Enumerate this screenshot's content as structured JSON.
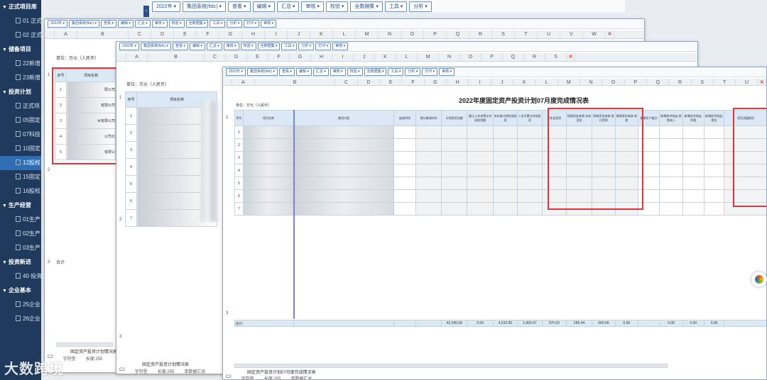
{
  "sidebar": {
    "groups": [
      {
        "label": "正式项目库",
        "items": [
          "01 正式",
          "02 正式"
        ]
      },
      {
        "label": "储备项目",
        "items": [
          "22新增",
          "23新增"
        ]
      },
      {
        "label": "投资计划",
        "items": [
          "正式项",
          "05固定",
          "07科技",
          "10固定",
          "12股权",
          "15固定",
          "16股权"
        ]
      },
      {
        "label": "生产经营",
        "items": [
          "01生产",
          "02生产",
          "03生产"
        ]
      },
      {
        "label": "投资新进",
        "items": [
          "40 投资"
        ]
      },
      {
        "label": "企业基本",
        "items": [
          "25企业",
          "26企业"
        ]
      }
    ],
    "active_item": "12股权"
  },
  "toolbar_top": [
    "2022年",
    "集团系统(fidc)",
    "查看",
    "编辑",
    "汇总",
    "审核",
    "校验",
    "全数据集",
    "工具",
    "分析"
  ],
  "toolbar_small": [
    "2022年",
    "集团系统(fidc)",
    "查看",
    "编辑",
    "汇总",
    "审核",
    "校验",
    "全数据集",
    "工具",
    "分析",
    "打印",
    "审核"
  ],
  "window1": {
    "columns": [
      "A",
      "B",
      "C",
      "D",
      "E",
      "F",
      "G",
      "H",
      "I",
      "J",
      "K",
      "L",
      "M",
      "N",
      "O",
      "P",
      "Q",
      "R",
      "S",
      "T",
      "U",
      "V",
      "W"
    ],
    "unit_label": "单位：万元（人民币）",
    "headers": [
      "序号",
      "项目名称"
    ],
    "rows": [
      {
        "no": "1",
        "name": "限公司"
      },
      {
        "no": "2",
        "name": "有限公司"
      },
      {
        "no": "3",
        "name": "水有限公司"
      },
      {
        "no": "4",
        "name": "公司北"
      },
      {
        "no": "5",
        "name": "有限公"
      }
    ],
    "total_label": "合计",
    "sheet_tab": "固定资产投资计划情况表",
    "status": [
      "C2",
      "字符型",
      "长度:255"
    ]
  },
  "window2": {
    "columns": [
      "A",
      "B",
      "C",
      "D",
      "E",
      "F",
      "G",
      "H",
      "I",
      "J",
      "K",
      "L",
      "M",
      "N",
      "O",
      "P",
      "Q",
      "R",
      "S"
    ],
    "unit_label": "单位：万元（人民币）",
    "headers": [
      "序号",
      "项目名称"
    ],
    "rows": [
      {
        "no": "1",
        "name": "有限公司"
      },
      {
        "no": "2",
        "name": "有限公司"
      },
      {
        "no": "3",
        "name": "有限公司"
      },
      {
        "no": "4",
        "name": "有限公司"
      },
      {
        "no": "5",
        "name": "有限公司"
      },
      {
        "no": "6",
        "name": "有限公司"
      },
      {
        "no": "7",
        "name": "有限公司"
      }
    ],
    "sheet_tab": "固定资产投资计划情况表",
    "status": [
      "C2",
      "字符型",
      "长度:255",
      "单数据汇总"
    ]
  },
  "window3": {
    "columns": [
      "A",
      "B",
      "C",
      "D",
      "E",
      "F",
      "G",
      "H",
      "I",
      "J",
      "K",
      "L",
      "M",
      "N",
      "O",
      "P",
      "Q",
      "R",
      "S",
      "T",
      "U"
    ],
    "title": "2022年度固定资产投资计划07月度完成情况表",
    "unit_label": "单位：万元（人民币）",
    "headers": [
      "序号",
      "项目名称",
      "建设内容",
      "起始时间",
      "预计建成时间",
      "计划投资总额",
      "截止上年末累计完成投资额",
      "本年度计划完成投资",
      "1-本月累计完成投资",
      "资本金投资",
      "财政资金来源-自有资金",
      "财政资金来源-银行贷款",
      "财政资金来源-其他",
      "新增生产能力",
      "新增经济效益-销售收入",
      "新增经济效益-利税",
      "新增经济效益-税金",
      "项目进展情况"
    ],
    "rows": [
      "1",
      "2",
      "3",
      "4",
      "5",
      "6",
      "7"
    ],
    "totals": {
      "label": "合计",
      "plan_total": "42,545.68",
      "prior_total": "0.00",
      "year_plan": "4,532.90",
      "ytd": "1,905.07",
      "capital": "375.00",
      "own_funds": "285.44",
      "bank_loan": "665.66",
      "other": "0.00",
      "v1": "0.00",
      "v2": "0.00",
      "v3": "0.00"
    },
    "sheet_tab": "固定资产投资计划07月度完成情况表",
    "status": [
      "C2",
      "字符型",
      "长度:255",
      "单数据汇总"
    ]
  },
  "watermark": "大数跨境"
}
